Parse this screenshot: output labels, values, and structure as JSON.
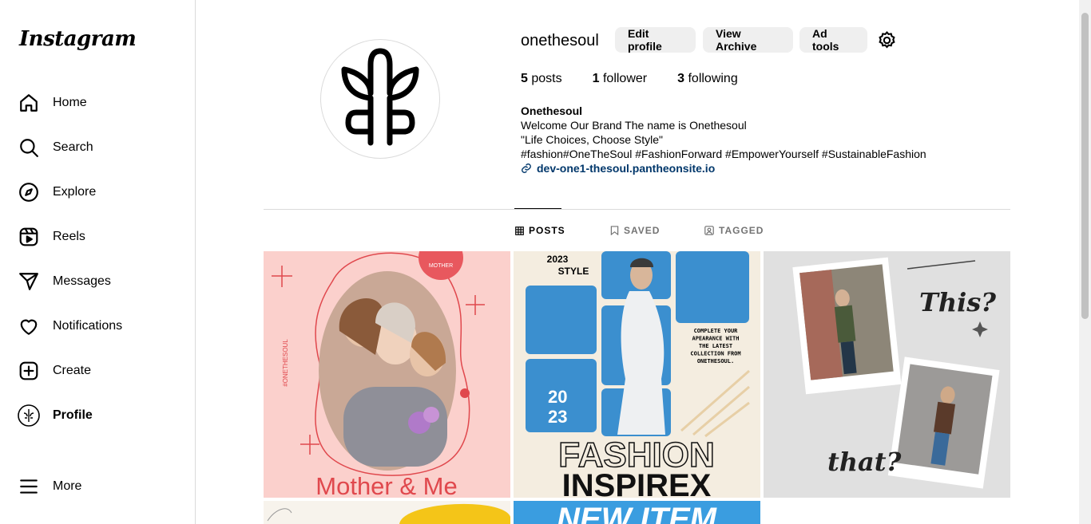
{
  "app": {
    "logo": "Instagram"
  },
  "sidebar": {
    "items": [
      {
        "label": "Home",
        "icon": "home-icon"
      },
      {
        "label": "Search",
        "icon": "search-icon"
      },
      {
        "label": "Explore",
        "icon": "compass-icon"
      },
      {
        "label": "Reels",
        "icon": "reels-icon"
      },
      {
        "label": "Messages",
        "icon": "send-icon"
      },
      {
        "label": "Notifications",
        "icon": "heart-icon"
      },
      {
        "label": "Create",
        "icon": "plus-square-icon"
      },
      {
        "label": "Profile",
        "icon": "profile-avatar"
      },
      {
        "label": "More",
        "icon": "menu-icon"
      }
    ]
  },
  "profile": {
    "username": "onethesoul",
    "buttons": {
      "edit": "Edit profile",
      "archive": "View Archive",
      "ad_tools": "Ad tools"
    },
    "stats": {
      "posts_count": "5",
      "posts_label": "posts",
      "followers_count": "1",
      "followers_label": "follower",
      "following_count": "3",
      "following_label": "following"
    },
    "bio": {
      "name": "Onethesoul",
      "line1": "Welcome Our Brand The name is Onethesoul",
      "line2": "\"Life Choices, Choose Style\"",
      "line3": "#fashion#OneTheSoul #FashionForward #EmpowerYourself #SustainableFashion",
      "link": "dev-one1-thesoul.pantheonsite.io"
    }
  },
  "tabs": [
    {
      "label": "POSTS",
      "icon": "grid-icon",
      "active": true
    },
    {
      "label": "SAVED",
      "icon": "bookmark-icon",
      "active": false
    },
    {
      "label": "TAGGED",
      "icon": "tag-person-icon",
      "active": false
    }
  ],
  "posts": {
    "post1": {
      "title": "Mother & Me",
      "tag": "#ONETHESOUL",
      "badge": "MOTHER"
    },
    "post2": {
      "top": "2023",
      "top2": "STYLE",
      "year1": "20",
      "year2": "23",
      "copy": "COMPLETE YOUR APEARANCE WITH THE LATEST COLLECTION FROM ONETHESOUL.",
      "headline1": "FASHION",
      "headline2": "INSPIREX"
    },
    "post3": {
      "word1": "This?",
      "word2": "that?"
    },
    "post5": {
      "banner": "NEW ITEM"
    }
  },
  "colors": {
    "accent_link": "#00376b",
    "button_bg": "#efefef",
    "border": "#dbdbdb",
    "post1_bg": "#fbd0cc",
    "post1_red": "#e0484d",
    "post2_blue": "#3b8fcf",
    "post2_cream": "#f4ede0"
  }
}
